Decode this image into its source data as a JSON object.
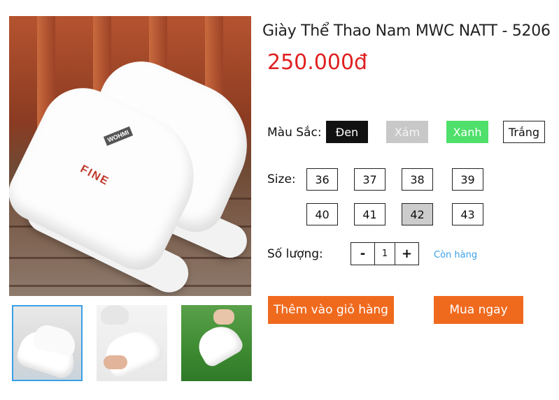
{
  "product": {
    "title": "Giày Thể Thao Nam MWC NATT - 5206",
    "price": "250.000đ"
  },
  "main_image": {
    "shoe_brand_text": "FINE",
    "shoe_tag_text": "WOHMI"
  },
  "thumbnails": [
    {
      "alt": "shoe-in-box",
      "selected": true
    },
    {
      "alt": "shoe-held",
      "selected": false
    },
    {
      "alt": "shoe-on-grass",
      "selected": false
    }
  ],
  "colors": {
    "label": "Màu Sắc:",
    "options": [
      {
        "label": "Đen",
        "color": "#111111"
      },
      {
        "label": "Xám",
        "color": "#c8c8c8"
      },
      {
        "label": "Xanh",
        "color": "#4ee06a"
      },
      {
        "label": "Trắng",
        "color": "#ffffff"
      }
    ]
  },
  "sizes": {
    "label": "Size:",
    "options": [
      "36",
      "37",
      "38",
      "39",
      "40",
      "41",
      "42",
      "43"
    ],
    "selected": "42"
  },
  "quantity": {
    "label": "Số lượng:",
    "minus": "-",
    "value": "1",
    "plus": "+",
    "stock_status": "Còn hàng"
  },
  "actions": {
    "add_to_cart": "Thêm vào giỏ hàng",
    "buy_now": "Mua ngay"
  },
  "theme": {
    "price_color": "#e02020",
    "action_color": "#f06a1e",
    "link_color": "#3aa0e6"
  }
}
